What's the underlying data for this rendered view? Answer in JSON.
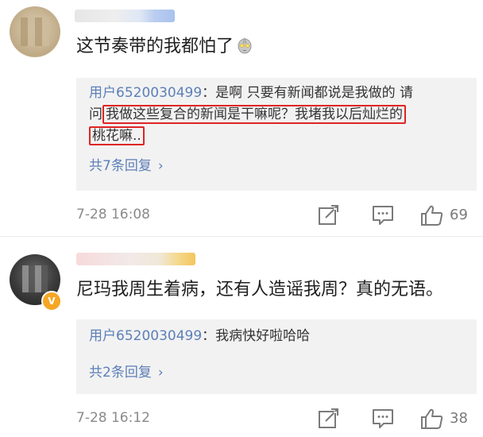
{
  "comments": [
    {
      "content": "这节奏带的我都怕了",
      "emoji_icon": "ultraman-emoji-icon",
      "reply": {
        "user": "用户6520030499",
        "lines": {
          "l1_text": "：是啊 只要有新闻都说是我做的 请",
          "l2_pre": "问",
          "l2_hl": "我做这些复合的新闻是干嘛呢？我堵我以后灿烂的",
          "l3_hl": "桃花嘛.."
        }
      },
      "more_label": "共7条回复",
      "timestamp": "7-28 16:08",
      "likes": "69"
    },
    {
      "content": "尼玛我周生着病，还有人造谣我周？真的无语。",
      "verified_badge": "V",
      "reply": {
        "user": "用户6520030499",
        "text": "：我病快好啦哈哈"
      },
      "more_label": "共2条回复",
      "timestamp": "7-28 16:12",
      "likes": "38"
    }
  ],
  "colors": {
    "link": "#5c7fb8",
    "highlight_box": "#e02424",
    "reply_bg": "#f2f2f2",
    "verified": "#f5a623"
  }
}
